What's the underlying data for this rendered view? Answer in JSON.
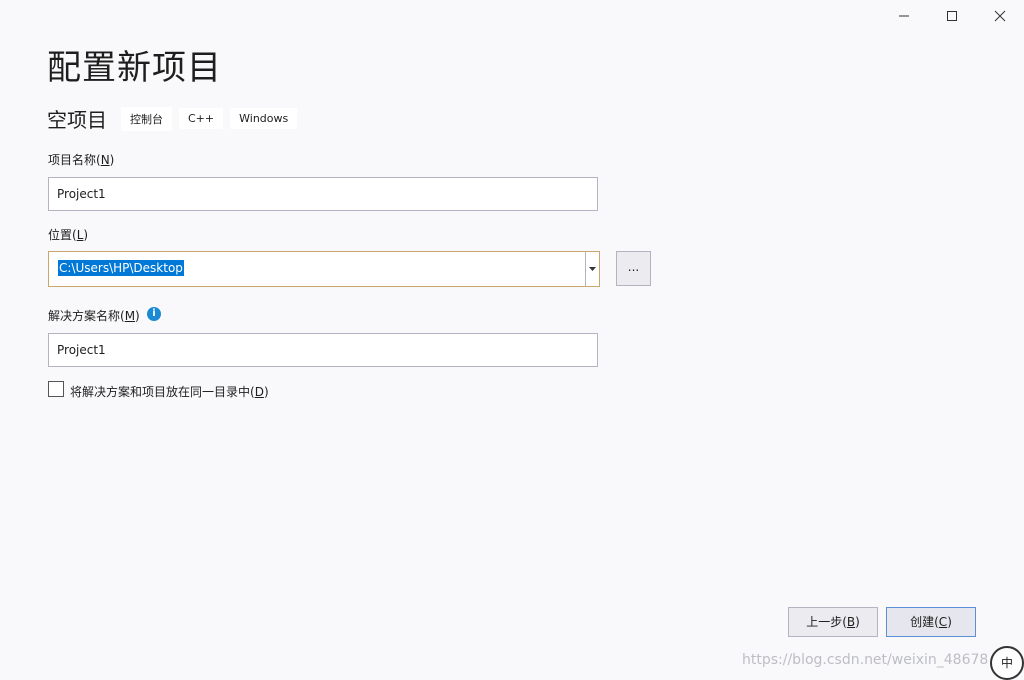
{
  "window": {
    "minimize_icon": "minimize-icon",
    "maximize_icon": "maximize-icon",
    "close_icon": "close-icon"
  },
  "header": {
    "title": "配置新项目",
    "template_name": "空项目",
    "tags": [
      "控制台",
      "C++",
      "Windows"
    ]
  },
  "form": {
    "project_name": {
      "label": "项目名称(",
      "mnemonic": "N",
      "label_end": ")",
      "value": "Project1"
    },
    "location": {
      "label": "位置(",
      "mnemonic": "L",
      "label_end": ")",
      "value": "C:\\Users\\HP\\Desktop",
      "browse_label": "..."
    },
    "solution_name": {
      "label": "解决方案名称(",
      "mnemonic": "M",
      "label_end": ")",
      "value": "Project1",
      "info_icon": "info-icon"
    },
    "same_dir": {
      "label": "将解决方案和项目放在同一目录中(",
      "mnemonic": "D",
      "label_end": ")",
      "checked": false
    }
  },
  "footer": {
    "back_label": "上一步(",
    "back_mnemonic": "B",
    "back_end": ")",
    "create_label": "创建(",
    "create_mnemonic": "C",
    "create_end": ")"
  },
  "watermark": "https://blog.csdn.net/weixin_48678",
  "avatar_text": "中",
  "colors": {
    "background": "#f9f9fb",
    "selection": "#0078d7",
    "focus_border": "#c7a76b",
    "info": "#1a8ad4",
    "primary_border": "#5b8fd6"
  }
}
